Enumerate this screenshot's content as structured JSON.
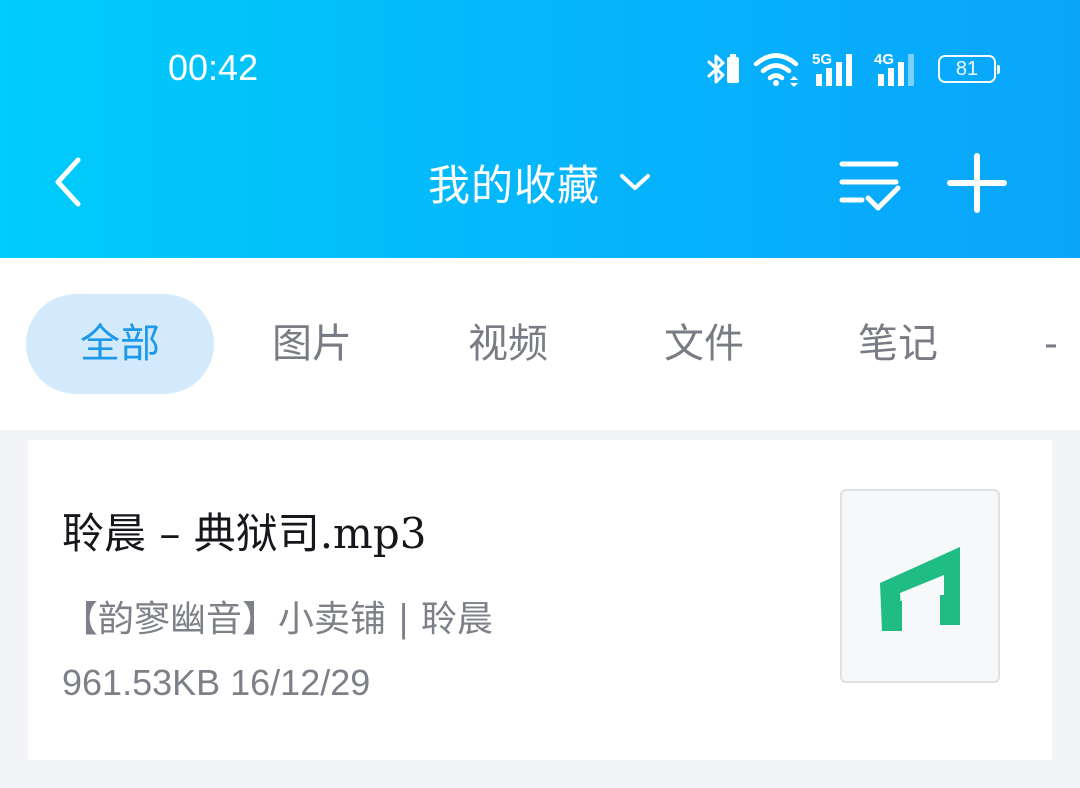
{
  "status_bar": {
    "time": "00:42",
    "battery": "81",
    "icons": [
      "bluetooth-icon",
      "battery-small-icon",
      "wifi-icon",
      "signal-5g-icon",
      "signal-4g-icon",
      "battery-icon"
    ],
    "labels": {
      "net_5g": "5G",
      "net_4g": "4G"
    }
  },
  "header": {
    "title": "我的收藏",
    "colors": {
      "gradient_start": "#00cdfa",
      "gradient_end": "#0aa5fb"
    }
  },
  "tabs": [
    {
      "label": "全部",
      "active": true
    },
    {
      "label": "图片",
      "active": false
    },
    {
      "label": "视频",
      "active": false
    },
    {
      "label": "文件",
      "active": false
    },
    {
      "label": "笔记",
      "active": false
    },
    {
      "label": "-",
      "active": false
    }
  ],
  "favorites": [
    {
      "title": "聆晨 – 典狱司.mp3",
      "source": "【韵寥幽音】小卖铺 | 聆晨",
      "meta": "961.53KB 16/12/29",
      "icon": "music-note-icon",
      "icon_color": "#1fbd83"
    }
  ],
  "colors": {
    "accent": "#1c99ea",
    "active_tab_bg": "#d2eafb"
  }
}
